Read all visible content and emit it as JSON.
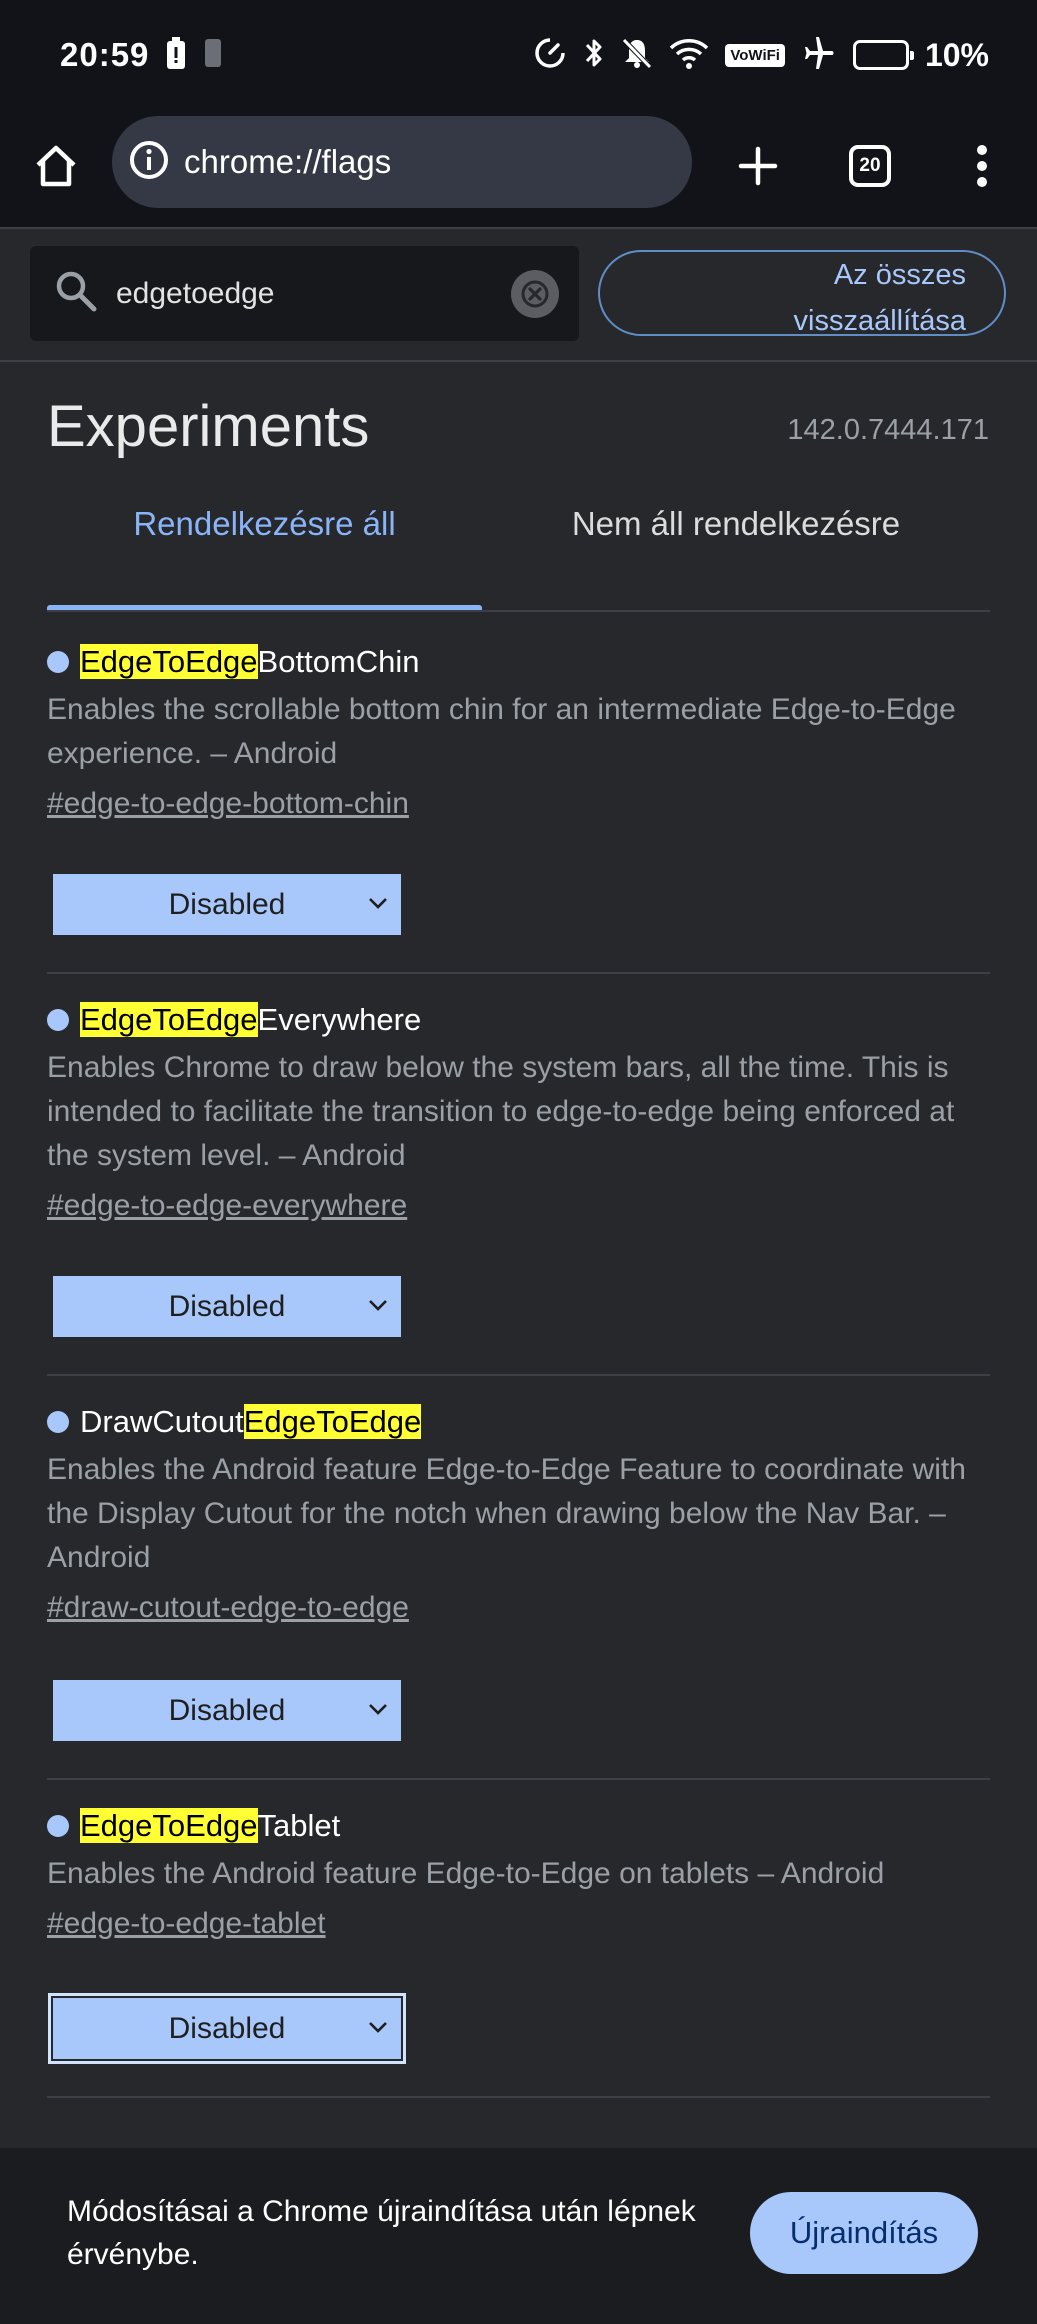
{
  "status_bar": {
    "time": "20:59",
    "battery_percent": "10%",
    "vowifi_label": "VoWiFi",
    "battery_level": 0.1
  },
  "toolbar": {
    "url": "chrome://flags",
    "tab_count": "20"
  },
  "search": {
    "value": "edgetoedge"
  },
  "reset_all": {
    "label_line1": "Az összes",
    "label_line2": "visszaállítása"
  },
  "header": {
    "title": "Experiments",
    "version": "142.0.7444.171"
  },
  "tabs": [
    {
      "label": "Rendelkezésre áll",
      "selected": true
    },
    {
      "label": "Nem áll rendelkezésre",
      "selected": false
    }
  ],
  "experiments": [
    {
      "name_before": "",
      "name_highlight": "EdgeToEdge",
      "name_after": "BottomChin",
      "description": "Enables the scrollable bottom chin for an intermediate Edge-to-Edge experience. – Android",
      "link": "#edge-to-edge-bottom-chin",
      "selected_option": "Disabled"
    },
    {
      "name_before": "",
      "name_highlight": "EdgeToEdge",
      "name_after": "Everywhere",
      "description": "Enables Chrome to draw below the system bars, all the time. This is intended to facilitate the transition to edge-to-edge being enforced at the system level. – Android",
      "link": "#edge-to-edge-everywhere",
      "selected_option": "Disabled"
    },
    {
      "name_before": "DrawCutout",
      "name_highlight": "EdgeToEdge",
      "name_after": "",
      "description": "Enables the Android feature Edge-to-Edge Feature to coordinate with the Display Cutout for the notch when drawing below the Nav Bar. – Android",
      "link": "#draw-cutout-edge-to-edge",
      "selected_option": "Disabled"
    },
    {
      "name_before": "",
      "name_highlight": "EdgeToEdge",
      "name_after": "Tablet",
      "description": "Enables the Android feature Edge-to-Edge on tablets – Android",
      "link": "#edge-to-edge-tablet",
      "selected_option": "Disabled"
    }
  ],
  "restart_bar": {
    "message": "Módosításai a Chrome újraindítása után lépnek érvénybe.",
    "button_label": "Újraindítás"
  },
  "colors": {
    "accent": "#a8c7fa",
    "highlight": "#ffff33",
    "background": "#27282c"
  }
}
